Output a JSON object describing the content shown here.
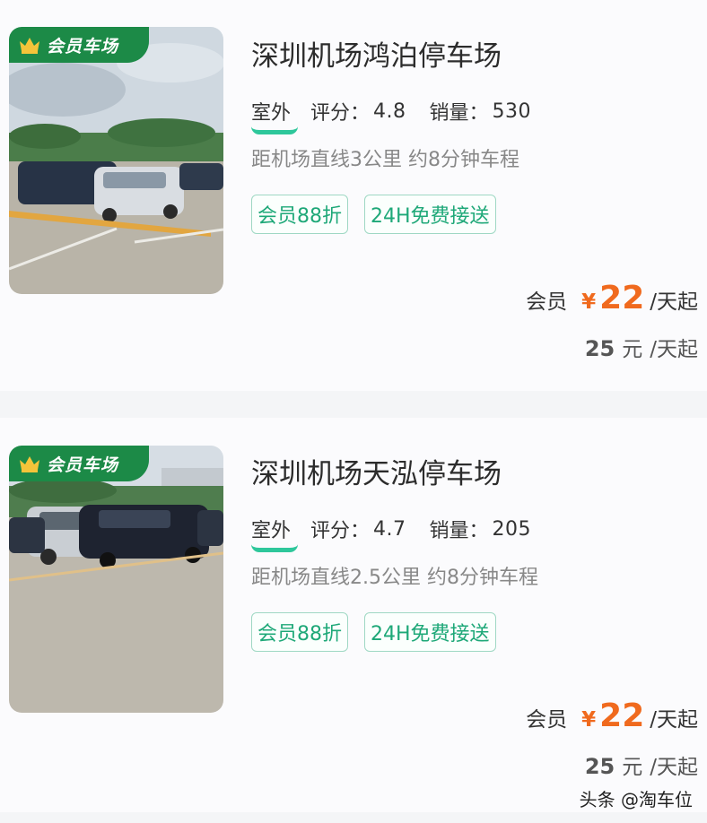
{
  "listings": [
    {
      "badge": "会员车场",
      "name": "深圳机场鸿泊停车场",
      "type": "室外",
      "rating_label": "评分：",
      "rating": "4.8",
      "sales_label": "销量：",
      "sales": "530",
      "distance": "距机场直线3公里 约8分钟车程",
      "tags": [
        "会员88折",
        "24H免费接送"
      ],
      "member_label": "会员",
      "currency": "¥",
      "member_price": "22",
      "price_unit": "/天起",
      "original_price": "25",
      "original_unit": "元",
      "original_suffix": "/天起"
    },
    {
      "badge": "会员车场",
      "name": "深圳机场天泓停车场",
      "type": "室外",
      "rating_label": "评分：",
      "rating": "4.7",
      "sales_label": "销量：",
      "sales": "205",
      "distance": "距机场直线2.5公里 约8分钟车程",
      "tags": [
        "会员88折",
        "24H免费接送"
      ],
      "member_label": "会员",
      "currency": "¥",
      "member_price": "22",
      "price_unit": "/天起",
      "original_price": "25",
      "original_unit": "元",
      "original_suffix": "/天起"
    }
  ],
  "watermark": "头条 @淘车位",
  "colors": {
    "badge_green": "#1c8a47",
    "tag_green": "#1ea878",
    "price_orange": "#f06a1e",
    "underline_teal": "#2ec79b"
  }
}
